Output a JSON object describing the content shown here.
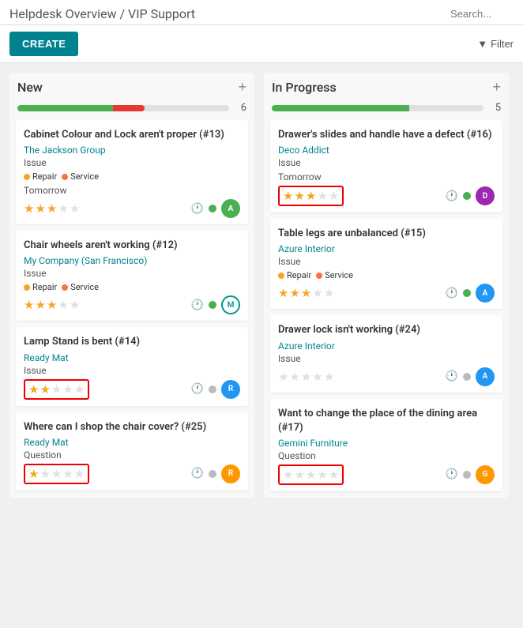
{
  "header": {
    "title": "Helpdesk Overview / VIP Support",
    "search_placeholder": "Search..."
  },
  "toolbar": {
    "create_label": "CREATE",
    "filter_label": "Filter"
  },
  "columns": [
    {
      "id": "new",
      "title": "New",
      "count": "6",
      "progress_green": 45,
      "progress_red": 15,
      "cards": [
        {
          "id": "card-1",
          "title": "Cabinet Colour and Lock aren't proper (#13)",
          "company": "The Jackson Group",
          "type": "Issue",
          "tags": [
            {
              "label": "Repair",
              "color": "#f5a623"
            },
            {
              "label": "Service",
              "color": "#ff7043"
            }
          ],
          "date": "Tomorrow",
          "stars": 3,
          "max_stars": 5,
          "status_color": "#4caf50",
          "avatar_letter": "A",
          "avatar_class": "avatar-green",
          "stars_outlined": false
        },
        {
          "id": "card-2",
          "title": "Chair wheels aren't working (#12)",
          "company": "My Company (San Francisco)",
          "type": "Issue",
          "tags": [
            {
              "label": "Repair",
              "color": "#f5a623"
            },
            {
              "label": "Service",
              "color": "#ff7043"
            }
          ],
          "date": "",
          "stars": 3,
          "max_stars": 5,
          "status_color": "#4caf50",
          "avatar_letter": "M",
          "avatar_class": "avatar-teal",
          "stars_outlined": false,
          "avatar_multi": true
        },
        {
          "id": "card-3",
          "title": "Lamp Stand is bent (#14)",
          "company": "Ready Mat",
          "type": "Issue",
          "tags": [],
          "date": "",
          "stars": 2,
          "max_stars": 5,
          "status_color": "#bbb",
          "avatar_letter": "R",
          "avatar_class": "avatar-blue",
          "stars_outlined": true
        },
        {
          "id": "card-4",
          "title": "Where can I shop the chair cover? (#25)",
          "company": "Ready Mat",
          "type": "Question",
          "tags": [],
          "date": "",
          "stars": 1,
          "max_stars": 5,
          "status_color": "#bbb",
          "avatar_letter": "R",
          "avatar_class": "avatar-orange",
          "stars_outlined": true
        }
      ]
    },
    {
      "id": "in-progress",
      "title": "In Progress",
      "count": "5",
      "progress_green": 65,
      "progress_red": 0,
      "cards": [
        {
          "id": "card-5",
          "title": "Drawer's slides and handle have a defect (#16)",
          "company": "Deco Addict",
          "type": "Issue",
          "tags": [],
          "date": "Tomorrow",
          "stars": 3,
          "max_stars": 5,
          "status_color": "#4caf50",
          "avatar_letter": "D",
          "avatar_class": "avatar-purple",
          "stars_outlined": true
        },
        {
          "id": "card-6",
          "title": "Table legs are unbalanced (#15)",
          "company": "Azure Interior",
          "type": "Issue",
          "tags": [
            {
              "label": "Repair",
              "color": "#f5a623"
            },
            {
              "label": "Service",
              "color": "#ff7043"
            }
          ],
          "date": "",
          "stars": 3,
          "max_stars": 5,
          "status_color": "#4caf50",
          "avatar_letter": "A",
          "avatar_class": "avatar-blue",
          "stars_outlined": false
        },
        {
          "id": "card-7",
          "title": "Drawer lock isn't working (#24)",
          "company": "Azure Interior",
          "type": "Issue",
          "tags": [],
          "date": "",
          "stars": 0,
          "max_stars": 5,
          "status_color": "#bbb",
          "avatar_letter": "A",
          "avatar_class": "avatar-blue",
          "stars_outlined": false
        },
        {
          "id": "card-8",
          "title": "Want to change the place of the dining area (#17)",
          "company": "Gemini Furniture",
          "type": "Question",
          "tags": [],
          "date": "",
          "stars": 0,
          "max_stars": 5,
          "status_color": "#bbb",
          "avatar_letter": "G",
          "avatar_class": "avatar-orange",
          "stars_outlined": true
        }
      ]
    }
  ]
}
